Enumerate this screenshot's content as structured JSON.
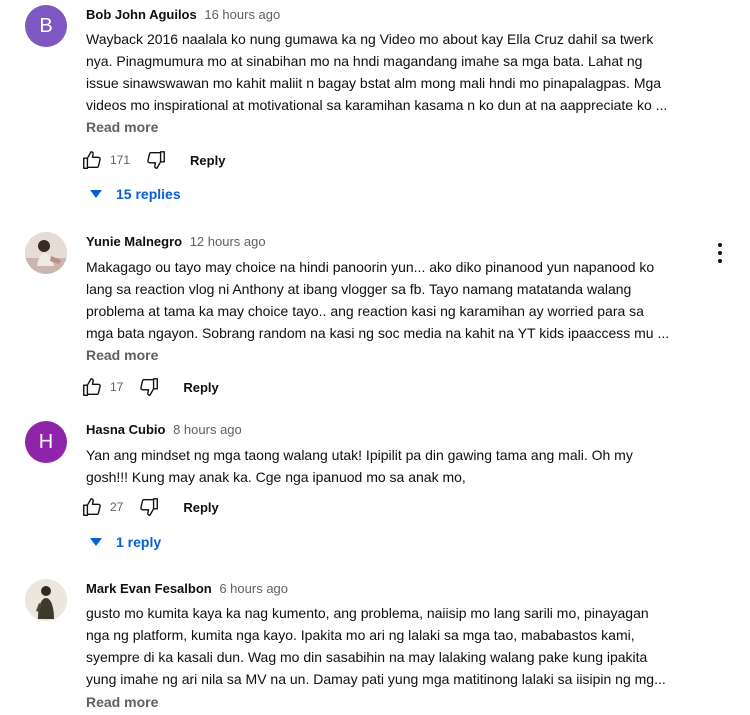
{
  "comments": [
    {
      "author": "Bob John Aguilos",
      "time": "16 hours ago",
      "avatar_letter": "B",
      "avatar_color": "#7e57c2",
      "text_lines": [
        "Wayback 2016 naalala ko nung gumawa ka ng Video mo about kay Ella Cruz dahil sa twerk",
        "nya. Pinagmumura mo at sinabihan mo na hndi magandang imahe sa mga bata. Lahat ng",
        "issue sinawswawan mo kahit maliit n bagay bstat alm mong mali hndi mo pinapalagpas. Mga",
        "videos mo inspirational at motivational sa karamihan kasama n ko dun at na aappreciate ko ..."
      ],
      "read_more": "Read more",
      "likes": "171",
      "reply_label": "Reply",
      "replies_label": "15 replies"
    },
    {
      "author": "Yunie Malnegro",
      "time": "12 hours ago",
      "avatar_icon": "profile-photo",
      "text_lines": [
        "Makagago ou tayo may choice na hindi panoorin yun...  ako diko pinanood yun napanood ko",
        "lang sa reaction vlog ni Anthony at ibang vlogger sa fb. Tayo namang matatanda walang",
        "problema at tama ka may choice tayo.. ang reaction kasi ng karamihan ay worried para sa",
        "mga bata ngayon. Sobrang random na kasi ng soc media na kahit na YT kids ipaaccess mu ..."
      ],
      "read_more": "Read more",
      "likes": "17",
      "reply_label": "Reply"
    },
    {
      "author": "Hasna Cubio",
      "time": "8 hours ago",
      "avatar_letter": "H",
      "avatar_color": "#8e24aa",
      "text_lines": [
        "Yan ang mindset ng mga taong walang utak! Ipipilit pa din gawing tama ang mali. Oh my",
        "gosh!!! Kung may anak ka. Cge nga ipanuod mo sa anak mo,"
      ],
      "likes": "27",
      "reply_label": "Reply",
      "replies_label": "1 reply"
    },
    {
      "author": "Mark Evan Fesalbon",
      "time": "6 hours ago",
      "avatar_icon": "profile-photo",
      "text_lines": [
        "gusto mo kumita kaya ka nag kumento,  ang problema, naiisip mo lang sarili mo, pinayagan",
        "nga ng platform, kumita nga kayo. Ipakita mo ari ng lalaki sa mga tao, mababastos kami,",
        "syempre di ka kasali dun. Wag mo din sasabihin na may lalaking walang pake kung ipakita",
        "yung imahe ng ari nila sa MV na un. Damay pati yung mga matitinong lalaki sa iisipin ng mg..."
      ],
      "read_more": "Read more"
    }
  ],
  "icons": {
    "like": "thumbs-up-icon",
    "dislike": "thumbs-down-icon",
    "caret": "caret-down-icon",
    "menu": "more-vert-icon"
  },
  "colors": {
    "link_blue": "#065fd4",
    "secondary_text": "#606060"
  }
}
